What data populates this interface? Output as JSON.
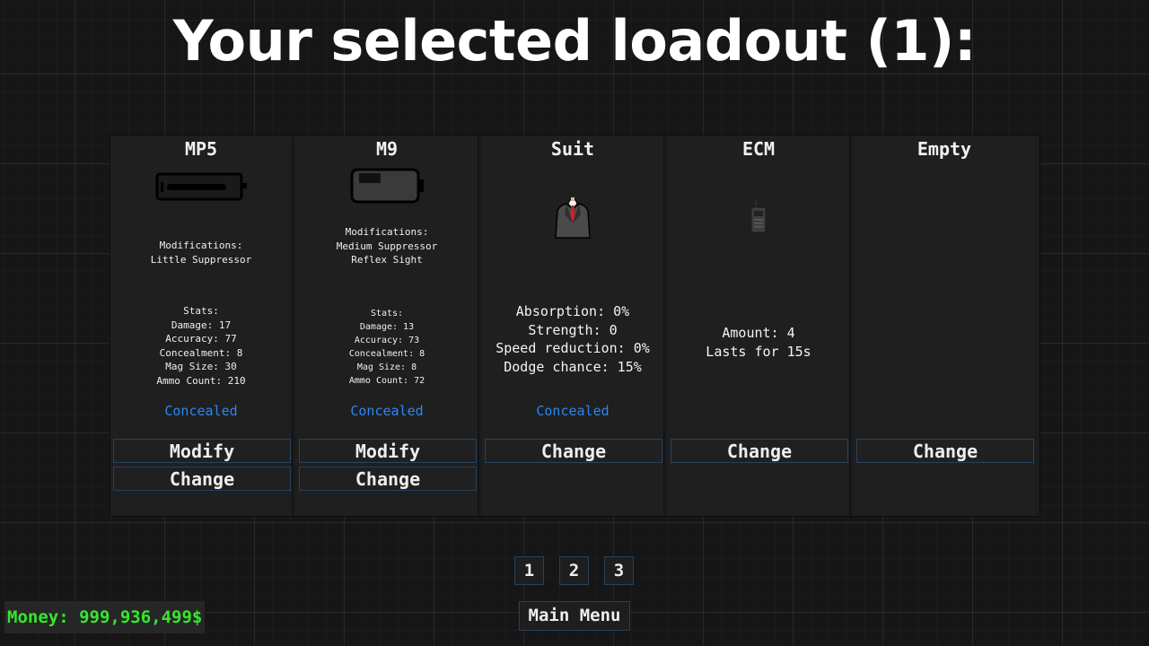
{
  "header": {
    "title": "Your selected loadout (1):"
  },
  "slots": [
    {
      "name": "MP5",
      "icon": "smg-icon",
      "mods_heading": "Modifications:",
      "mods": [
        "Little Suppressor"
      ],
      "stats_heading": "Stats:",
      "stats": [
        "Damage: 17",
        "Accuracy: 77",
        "Concealment: 8",
        "Mag Size: 30",
        "Ammo Count: 210"
      ],
      "status": "Concealed",
      "buttons": [
        "Modify",
        "Change"
      ]
    },
    {
      "name": "M9",
      "icon": "pistol-icon",
      "mods_heading": "Modifications:",
      "mods": [
        "Medium Suppressor",
        "Reflex Sight"
      ],
      "stats_heading": "Stats:",
      "stats": [
        "Damage: 13",
        "Accuracy: 73",
        "Concealment: 8",
        "Mag Size: 8",
        "Ammo Count: 72"
      ],
      "status": "Concealed",
      "buttons": [
        "Modify",
        "Change"
      ]
    },
    {
      "name": "Suit",
      "icon": "suit-icon",
      "stats": [
        "Absorption: 0%",
        "Strength: 0",
        "Speed reduction: 0%",
        "Dodge chance: 15%"
      ],
      "status": "Concealed",
      "buttons": [
        "Change"
      ]
    },
    {
      "name": "ECM",
      "icon": "ecm-device-icon",
      "stats": [
        "Amount: 4",
        "Lasts for 15s"
      ],
      "buttons": [
        "Change"
      ]
    },
    {
      "name": "Empty",
      "buttons": [
        "Change"
      ]
    }
  ],
  "pagination": {
    "pages": [
      "1",
      "2",
      "3"
    ]
  },
  "footer": {
    "main_menu_label": "Main Menu",
    "money": "Money: 999,936,499$"
  },
  "colors": {
    "concealed_text": "#2a86f0",
    "money_text": "#35e82c",
    "button_border": "#24425e"
  }
}
